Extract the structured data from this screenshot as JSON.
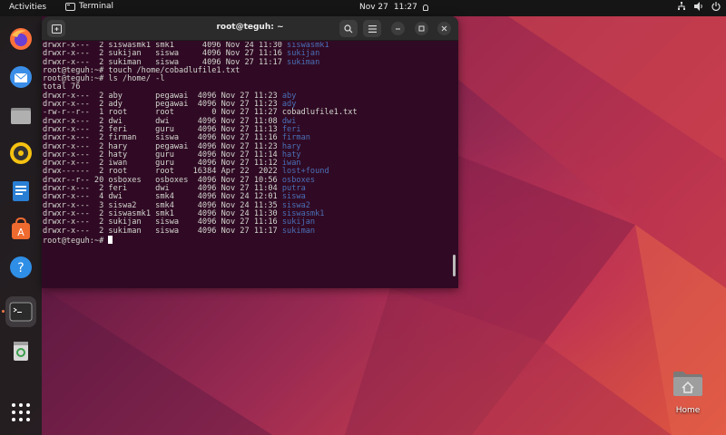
{
  "topbar": {
    "activities": "Activities",
    "app_name": "Terminal",
    "date": "Nov 27",
    "time": "11:27"
  },
  "dock": {
    "items": [
      {
        "name": "firefox-icon",
        "color": "#ff7139"
      },
      {
        "name": "thunderbird-icon",
        "color": "#3b8ee8"
      },
      {
        "name": "files-icon",
        "color": "#9b9b9b"
      },
      {
        "name": "rhythmbox-icon",
        "color": "#f5c211"
      },
      {
        "name": "writer-icon",
        "color": "#2a7fd4"
      },
      {
        "name": "software-icon",
        "color": "#ef6a2f"
      },
      {
        "name": "help-icon",
        "color": "#2f8ee6"
      },
      {
        "name": "terminal-icon",
        "color": "#3b3b3b"
      },
      {
        "name": "trash-icon",
        "color": "#8fbf6b"
      },
      {
        "name": "show-apps-icon",
        "color": "#ffffff"
      }
    ]
  },
  "terminal": {
    "title": "root@teguh: ~",
    "lines": [
      {
        "text": "drwxr-x---  2 siswasmk1 smk1      4096 Nov 24 11:30 ",
        "dir": "siswasmk1"
      },
      {
        "text": "drwxr-x---  2 sukijan   siswa     4096 Nov 27 11:16 ",
        "dir": "sukijan"
      },
      {
        "text": "drwxr-x---  2 sukiman   siswa     4096 Nov 27 11:17 ",
        "dir": "sukiman"
      },
      {
        "text": "root@teguh:~# touch /home/cobadlufile1.txt",
        "dir": ""
      },
      {
        "text": "root@teguh:~# ls /home/ -l",
        "dir": ""
      },
      {
        "text": "total 76",
        "dir": ""
      },
      {
        "text": "drwxr-x---  2 aby       pegawai  4096 Nov 27 11:23 ",
        "dir": "aby"
      },
      {
        "text": "drwxr-x---  2 ady       pegawai  4096 Nov 27 11:23 ",
        "dir": "ady"
      },
      {
        "text": "-rw-r--r--  1 root      root        0 Nov 27 11:27 cobadlufile1.txt",
        "dir": ""
      },
      {
        "text": "drwxr-x---  2 dwi       dwi      4096 Nov 27 11:08 ",
        "dir": "dwi"
      },
      {
        "text": "drwxr-x---  2 feri      guru     4096 Nov 27 11:13 ",
        "dir": "feri"
      },
      {
        "text": "drwxr-x---  2 firman    siswa    4096 Nov 27 11:16 ",
        "dir": "firman"
      },
      {
        "text": "drwxr-x---  2 hary      pegawai  4096 Nov 27 11:23 ",
        "dir": "hary"
      },
      {
        "text": "drwxr-x---  2 haty      guru     4096 Nov 27 11:14 ",
        "dir": "haty"
      },
      {
        "text": "drwxr-x---  2 iwan      guru     4096 Nov 27 11:12 ",
        "dir": "iwan"
      },
      {
        "text": "drwx------  2 root      root    16384 Apr 22  2022 ",
        "dir": "lost+found"
      },
      {
        "text": "drwxr--r-- 20 osboxes   osboxes  4096 Nov 27 10:56 ",
        "dir": "osboxes"
      },
      {
        "text": "drwxr-x---  2 feri      dwi      4096 Nov 27 11:04 ",
        "dir": "putra"
      },
      {
        "text": "drwxr-x---  4 dwi       smk4     4096 Nov 24 12:01 ",
        "dir": "siswa"
      },
      {
        "text": "drwxr-x---  3 siswa2    smk4     4096 Nov 24 11:35 ",
        "dir": "siswa2"
      },
      {
        "text": "drwxr-x---  2 siswasmk1 smk1     4096 Nov 24 11:30 ",
        "dir": "siswasmk1"
      },
      {
        "text": "drwxr-x---  2 sukijan   siswa    4096 Nov 27 11:16 ",
        "dir": "sukijan"
      },
      {
        "text": "drwxr-x---  2 sukiman   siswa    4096 Nov 27 11:17 ",
        "dir": "sukiman"
      }
    ],
    "prompt": "root@teguh:~# "
  },
  "desktop": {
    "home_label": "Home"
  }
}
